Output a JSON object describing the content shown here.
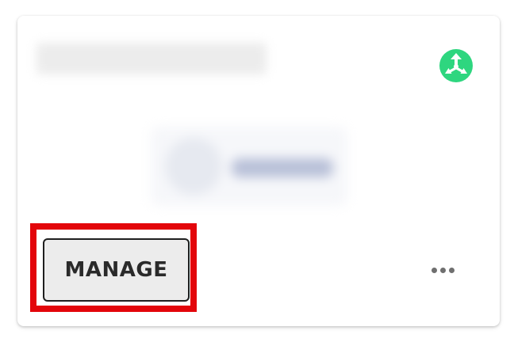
{
  "card": {
    "title": "",
    "status_icon": "move-arrows-icon",
    "status_color": "#2ed67f",
    "logo": "blurred-logo"
  },
  "actions": {
    "manage_label": "MANAGE",
    "more_icon": "more-horizontal-icon",
    "highlight_color": "#e3060b"
  }
}
